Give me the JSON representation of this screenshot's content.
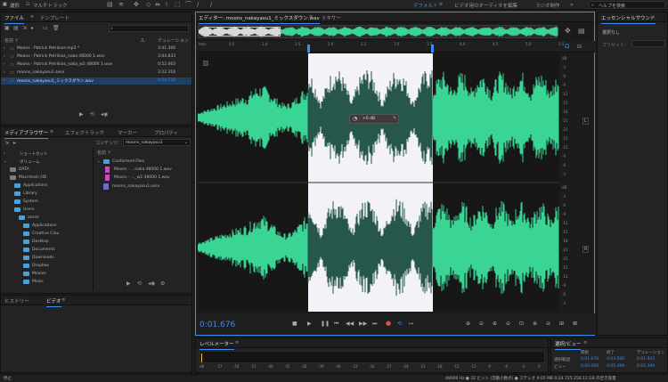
{
  "app": {
    "tabs": [
      "波形",
      "マルチトラック"
    ],
    "workspaces": [
      "デフォルト",
      "ビデオ用のオーディオを編集",
      "ラジオ制作"
    ],
    "help_search": "ヘルプを検索"
  },
  "files_panel": {
    "tabs": [
      "ファイル",
      "テンプレート"
    ],
    "col_name": "名前 ↑",
    "col_status": "ス.",
    "col_duration": "デュレーション",
    "rows": [
      {
        "name": "Moons - Patrick Petrikios.mp3 *",
        "dur": "3:41.366"
      },
      {
        "name": "Moons - Patrick Petrikios_naka 48000 1.wav",
        "dur": "3:04.833"
      },
      {
        "name": "Moons - Patrick Petrikios_naka_w2 48000 1.wav",
        "dur": "0:52.063"
      },
      {
        "name": "moons_nakayasu1.sesx",
        "dur": "3:22.316"
      },
      {
        "name": "moons_nakayasu1_ミックスダウン.wav",
        "dur": "0:24.725"
      }
    ]
  },
  "media_browser": {
    "tabs": [
      "メディアブラウザー",
      "エフェクトラック",
      "マーカー",
      "プロパティ"
    ],
    "content_label": "コンテンツ:",
    "content_value": "moons_nakayasu1",
    "shortcuts": "ショートカット",
    "volumes": "ボリューム",
    "tree": [
      "DATA",
      "Macintosh HD",
      "Applications",
      "Library",
      "System",
      "Users",
      "ancer",
      "Applications",
      "Creative Clou",
      "Desktop",
      "Documents",
      "Downloads",
      "Dropbox",
      "Movies",
      "Music"
    ],
    "name_col": "名前 ↑",
    "right_items": [
      "Conformed Files",
      "Moons - ...naka 48000 1.wav",
      "Moons - ..._w2 48000 1.wav",
      "moons_nakayasu1.sesx"
    ]
  },
  "bottom_left": {
    "tabs": [
      "ヒストリー",
      "ビデオ"
    ]
  },
  "editor": {
    "title": "エディター: moons_nakayasu1_ミックスダウン.wav",
    "mixer": "ミキサー",
    "time_display": "0:01.676",
    "ruler": [
      "hms",
      "0.5",
      "1.0",
      "1.5",
      "2.0",
      "2.5",
      "3.0",
      "3.5",
      "4.0",
      "4.5",
      "5.0",
      "5.5"
    ],
    "db_scale_top": [
      "dB",
      "-3",
      "-6",
      "-9",
      "-12",
      "-15",
      "-18",
      "-21",
      "-21",
      "-15",
      "-12",
      "-9",
      "-6",
      "-3"
    ],
    "db_scale_bottom": [
      "dB",
      "-3",
      "-6",
      "-9",
      "-12",
      "-15",
      "-18",
      "-21",
      "-21",
      "-15",
      "-12",
      "-9",
      "-6",
      "-3"
    ],
    "hud_db": "+0 dB",
    "channel_l": "L",
    "channel_r": "R",
    "colors": {
      "wave": "#3ad595",
      "wave_sel": "#26574a",
      "selection_bg": "#f2f2f8",
      "accent": "#3b8cf5"
    }
  },
  "essential_sound": {
    "title": "エッセンシャルサウンド",
    "none": "選択なし",
    "preset": "プリセット:"
  },
  "level_meter": {
    "title": "レベルメーター",
    "scale": [
      "dB",
      "-57",
      "-54",
      "-51",
      "-48",
      "-45",
      "-42",
      "-39",
      "-36",
      "-33",
      "-30",
      "-27",
      "-24",
      "-21",
      "-18",
      "-15",
      "-12",
      "-9",
      "-6",
      "-3",
      "0"
    ]
  },
  "selection_view": {
    "title": "選択/ビュー",
    "headers": [
      "開始",
      "終了",
      "デュレーション"
    ],
    "rows": [
      {
        "label": "選択範囲",
        "start": "0:01.676",
        "end": "0:03.590",
        "dur": "0:01.923"
      },
      {
        "label": "ビュー",
        "start": "0:00.000",
        "end": "0:05.399",
        "dur": "0:05.399"
      }
    ]
  },
  "status_bar": {
    "left": "停止",
    "right": "48000 Hz ● 32 ビット (浮動小数点) ● ステレオ   9.05 MB   0:24.725   258.12 GB の空き容量"
  }
}
